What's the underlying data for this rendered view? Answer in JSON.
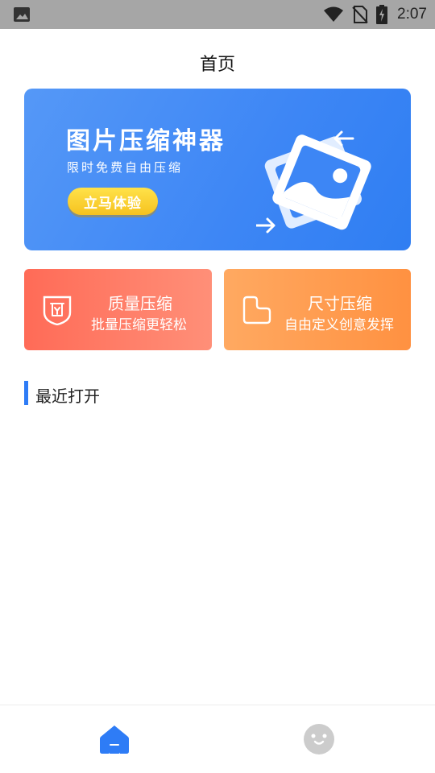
{
  "status_bar": {
    "time": "2:07",
    "icons": [
      "gallery-icon",
      "wifi-icon",
      "no-sim-icon",
      "battery-charging-icon"
    ]
  },
  "header": {
    "title": "首页"
  },
  "banner": {
    "title": "图片压缩神器",
    "subtitle": "限时免费自由压缩",
    "button_label": "立马体验",
    "icon": "image-compress-illustration"
  },
  "features": [
    {
      "title": "质量压缩",
      "subtitle": "批量压缩更轻松",
      "icon": "quality-shield-icon"
    },
    {
      "title": "尺寸压缩",
      "subtitle": "自由定义创意发挥",
      "icon": "size-crop-icon"
    }
  ],
  "recent": {
    "title": "最近打开"
  },
  "tabbar": {
    "items": [
      {
        "name": "home",
        "icon": "home-icon",
        "active": true
      },
      {
        "name": "profile",
        "icon": "smiley-face-icon",
        "active": false
      }
    ]
  },
  "colors": {
    "status_bar": "#a6a6a6",
    "primary_blue": "#2e7cf6",
    "banner_button": "#f6c21f",
    "quality_card": "#ff6b57",
    "size_card": "#ffa961",
    "tab_inactive": "#cccccc"
  }
}
